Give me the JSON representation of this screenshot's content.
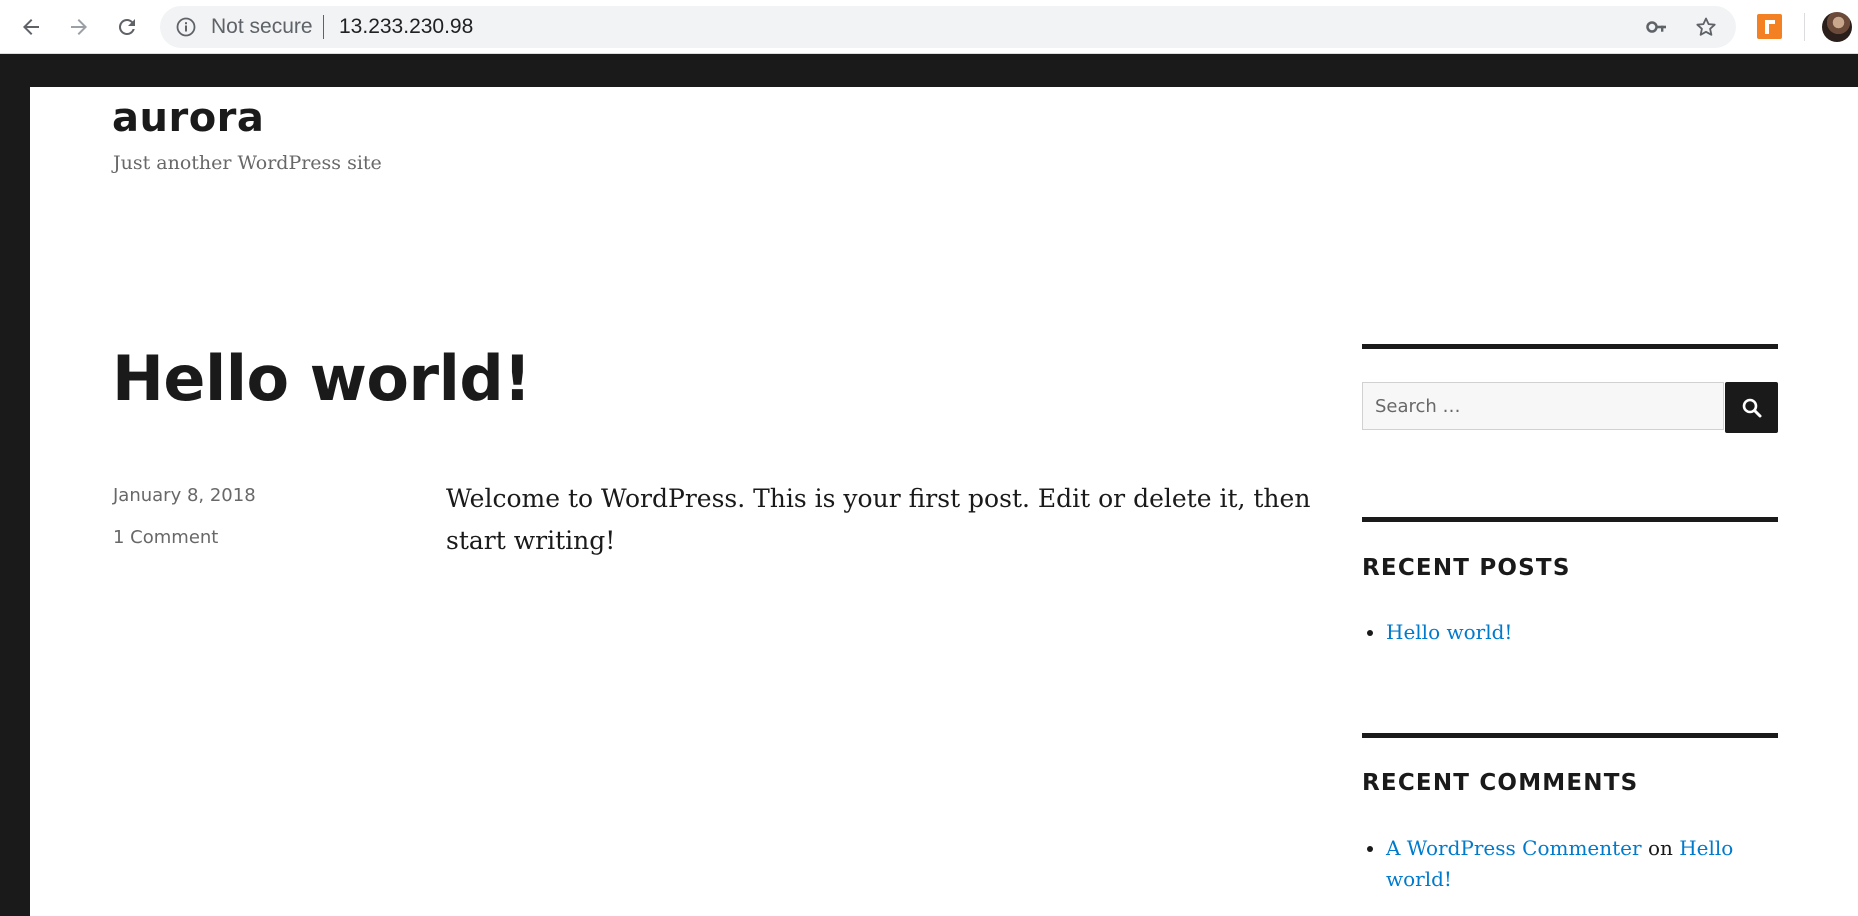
{
  "browser": {
    "security_label": "Not secure",
    "url": "13.233.230.98",
    "icons": [
      "back-icon",
      "forward-icon",
      "reload-icon",
      "info-icon",
      "key-icon",
      "star-icon",
      "extension-icon",
      "profile-avatar"
    ]
  },
  "site": {
    "title": "aurora",
    "description": "Just another WordPress site"
  },
  "post": {
    "title": "Hello world!",
    "date": "January 8, 2018",
    "comments": "1 Comment",
    "content": "Welcome to WordPress. This is your first post. Edit or delete it, then start writing!"
  },
  "sidebar": {
    "search_placeholder": "Search …",
    "recent_posts_title": "RECENT POSTS",
    "recent_posts": [
      "Hello world!"
    ],
    "recent_comments_title": "RECENT COMMENTS",
    "recent_comment": {
      "author": "A WordPress Commenter",
      "connector": "on",
      "post": "Hello world!"
    }
  },
  "colors": {
    "link": "#007acc",
    "text": "#1a1a1a",
    "meta": "#686868",
    "frame": "#1a1a1a",
    "extension": "#f48024"
  }
}
